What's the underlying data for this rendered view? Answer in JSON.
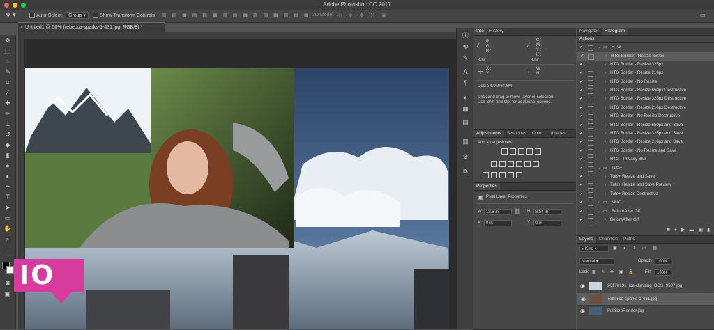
{
  "window": {
    "title": "Adobe Photoshop CC 2017"
  },
  "options_bar": {
    "auto_select_label": "Auto-Select:",
    "auto_select_value": "Group",
    "show_transform_label": "Show Transform Controls",
    "mode_3d_label": "3D Mode:"
  },
  "document": {
    "tab_title": "Untitled1 @ 50% (rebecca-sparks-1-431.jpg, RGB/8) *"
  },
  "info_panel": {
    "tabs": [
      "Info",
      "History"
    ],
    "r": "R :",
    "g": "G :",
    "b": "B :",
    "bit_left": "8-bit",
    "c": "C :",
    "m": "M :",
    "y": "Y :",
    "k": "K :",
    "bit_right": "8-bit",
    "x": "X :",
    "y_coord": "Y :",
    "w": "W :",
    "h": "H :",
    "doc_size": "Doc: 34.9M/64.6M",
    "hint_line1": "Click and drag to move layer or selection.",
    "hint_line2": "Use Shift and Opt for additional options."
  },
  "adjustments_panel": {
    "tabs": [
      "Adjustments",
      "Swatches",
      "Color",
      "Libraries"
    ],
    "add_label": "Add an adjustment"
  },
  "properties_panel": {
    "tab": "Properties",
    "title": "Pixel Layer Properties",
    "w_label": "W:",
    "w_value": "12.8 in",
    "h_label": "H:",
    "h_value": "8.54 in",
    "x_label": "X:",
    "x_value": "0 in",
    "y_label": "Y:",
    "y_value": "0 in"
  },
  "right_panel": {
    "top_tabs": [
      "Navigator",
      "Histogram"
    ],
    "actions_title": "Actions"
  },
  "actions": [
    {
      "label": "HTG",
      "level": 0,
      "type": "set",
      "open": true
    },
    {
      "label": "HTG Border - Resize 850px",
      "level": 1,
      "type": "action",
      "selected": true
    },
    {
      "label": "HTG Border - Resize 325px",
      "level": 1,
      "type": "action"
    },
    {
      "label": "HTG Border - Resize 216px",
      "level": 1,
      "type": "action"
    },
    {
      "label": "HTG Border - No Resize",
      "level": 1,
      "type": "action"
    },
    {
      "label": "HTG Border - Resize 650px Destructive",
      "level": 1,
      "type": "action"
    },
    {
      "label": "HTG Border - Resize 325px Destructive",
      "level": 1,
      "type": "action"
    },
    {
      "label": "HTG Border - Resize 216px Destructive",
      "level": 1,
      "type": "action"
    },
    {
      "label": "HTG Border - No Resize Destructive",
      "level": 1,
      "type": "action"
    },
    {
      "label": "HTG Border - Resize 650px and Save",
      "level": 1,
      "type": "action"
    },
    {
      "label": "HTG Border - Resize 325px and Save",
      "level": 1,
      "type": "action"
    },
    {
      "label": "HTG Border - Resize 216px and Save",
      "level": 1,
      "type": "action"
    },
    {
      "label": "HTG Border - No Resize and Save",
      "level": 1,
      "type": "action"
    },
    {
      "label": "HTG - Privacy Blur",
      "level": 1,
      "type": "action"
    },
    {
      "label": "Tuts+",
      "level": 0,
      "type": "set",
      "open": true
    },
    {
      "label": "Tuts+ Resize and Save",
      "level": 1,
      "type": "action"
    },
    {
      "label": "Tuts+ Resize and Save Preview",
      "level": 1,
      "type": "action"
    },
    {
      "label": "Tuts+ Resize Destructive",
      "level": 1,
      "type": "action"
    },
    {
      "label": "MUO",
      "level": 0,
      "type": "set",
      "open": false
    },
    {
      "label": "BeforeAfter Gif",
      "level": 0,
      "type": "set",
      "open": true
    },
    {
      "label": "BeforeAfter Gif",
      "level": 1,
      "type": "action"
    }
  ],
  "layers_panel": {
    "tabs": [
      "Layers",
      "Channels",
      "Paths"
    ],
    "kind_value": "Kind",
    "blend_mode": "Normal",
    "opacity_label": "Opacity:",
    "opacity_value": "100%",
    "lock_label": "Lock:",
    "fill_label": "Fill:",
    "fill_value": "100%",
    "layers": [
      {
        "name": "20170131_ice-climbing_BOS_9507.jpg",
        "selected": false
      },
      {
        "name": "rebecca-sparks-1-431.jpg",
        "selected": true
      },
      {
        "name": "FullSizeRender.jpg",
        "selected": false
      }
    ]
  },
  "watermark": {
    "text": "IO"
  },
  "colors": {
    "accent_magenta": "#d63b9d",
    "mac_close": "#fe5f57",
    "mac_minimize": "#febc2e",
    "mac_zoom": "#28c840",
    "panel_bg": "#474747",
    "canvas_bg": "#2b2b2b"
  },
  "icons": {
    "tools": [
      "move-icon",
      "marquee-icon",
      "lasso-icon",
      "quick-select-icon",
      "crop-icon",
      "eyedropper-icon",
      "healing-brush-icon",
      "brush-icon",
      "clone-stamp-icon",
      "history-brush-icon",
      "eraser-icon",
      "gradient-icon",
      "blur-icon",
      "dodge-icon",
      "pen-icon",
      "type-icon",
      "path-select-icon",
      "shape-icon",
      "hand-icon",
      "zoom-icon"
    ]
  }
}
